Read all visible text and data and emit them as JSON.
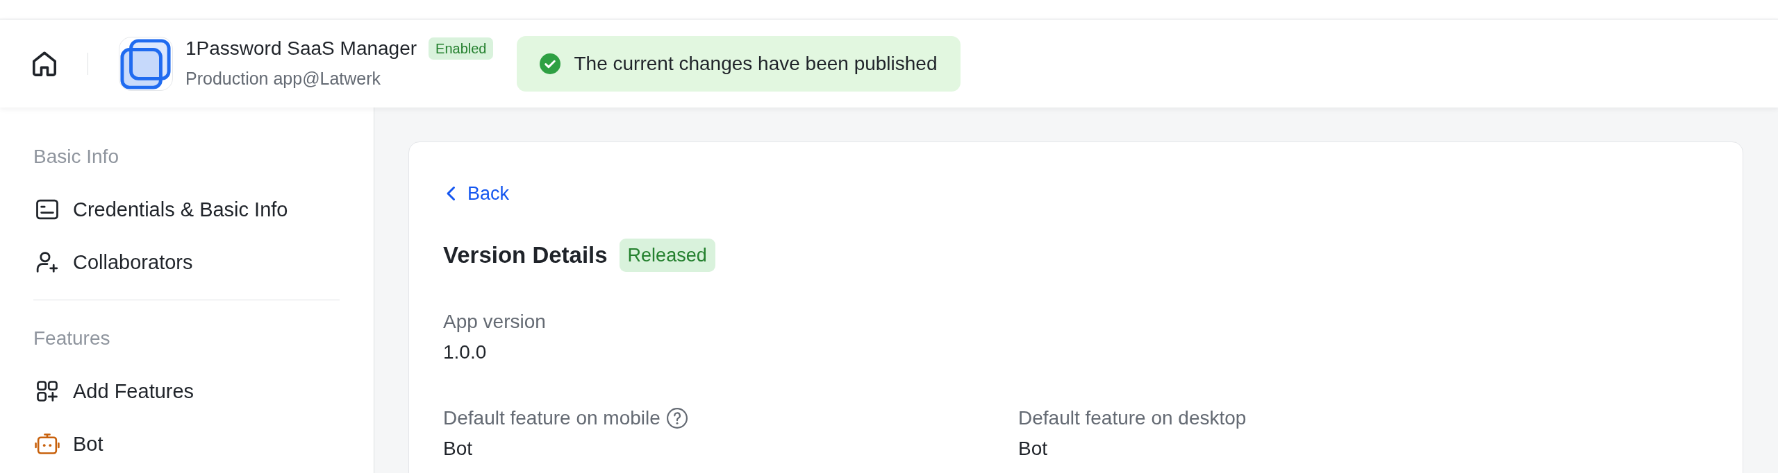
{
  "header": {
    "app": {
      "name": "1Password SaaS Manager",
      "status": "Enabled",
      "subtitle": "Production app@Latwerk"
    },
    "toast": {
      "kind": "success",
      "message": "The current changes have been published"
    }
  },
  "sidebar": {
    "sections": [
      {
        "title": "Basic Info",
        "items": [
          {
            "label": "Credentials & Basic Info",
            "selected": false
          },
          {
            "label": "Collaborators",
            "selected": false
          }
        ]
      },
      {
        "title": "Features",
        "items": [
          {
            "label": "Add Features",
            "selected": false
          },
          {
            "label": "Bot",
            "selected": false
          }
        ]
      }
    ]
  },
  "details": {
    "back": "Back",
    "title": "Version Details",
    "status": "Released",
    "rows": [
      [
        {
          "label": "App version",
          "value": "1.0.0"
        }
      ],
      [
        {
          "label": "Default feature on mobile",
          "help": true,
          "value": "Bot"
        },
        {
          "label": "Default feature on desktop",
          "value": "Bot"
        }
      ]
    ]
  }
}
